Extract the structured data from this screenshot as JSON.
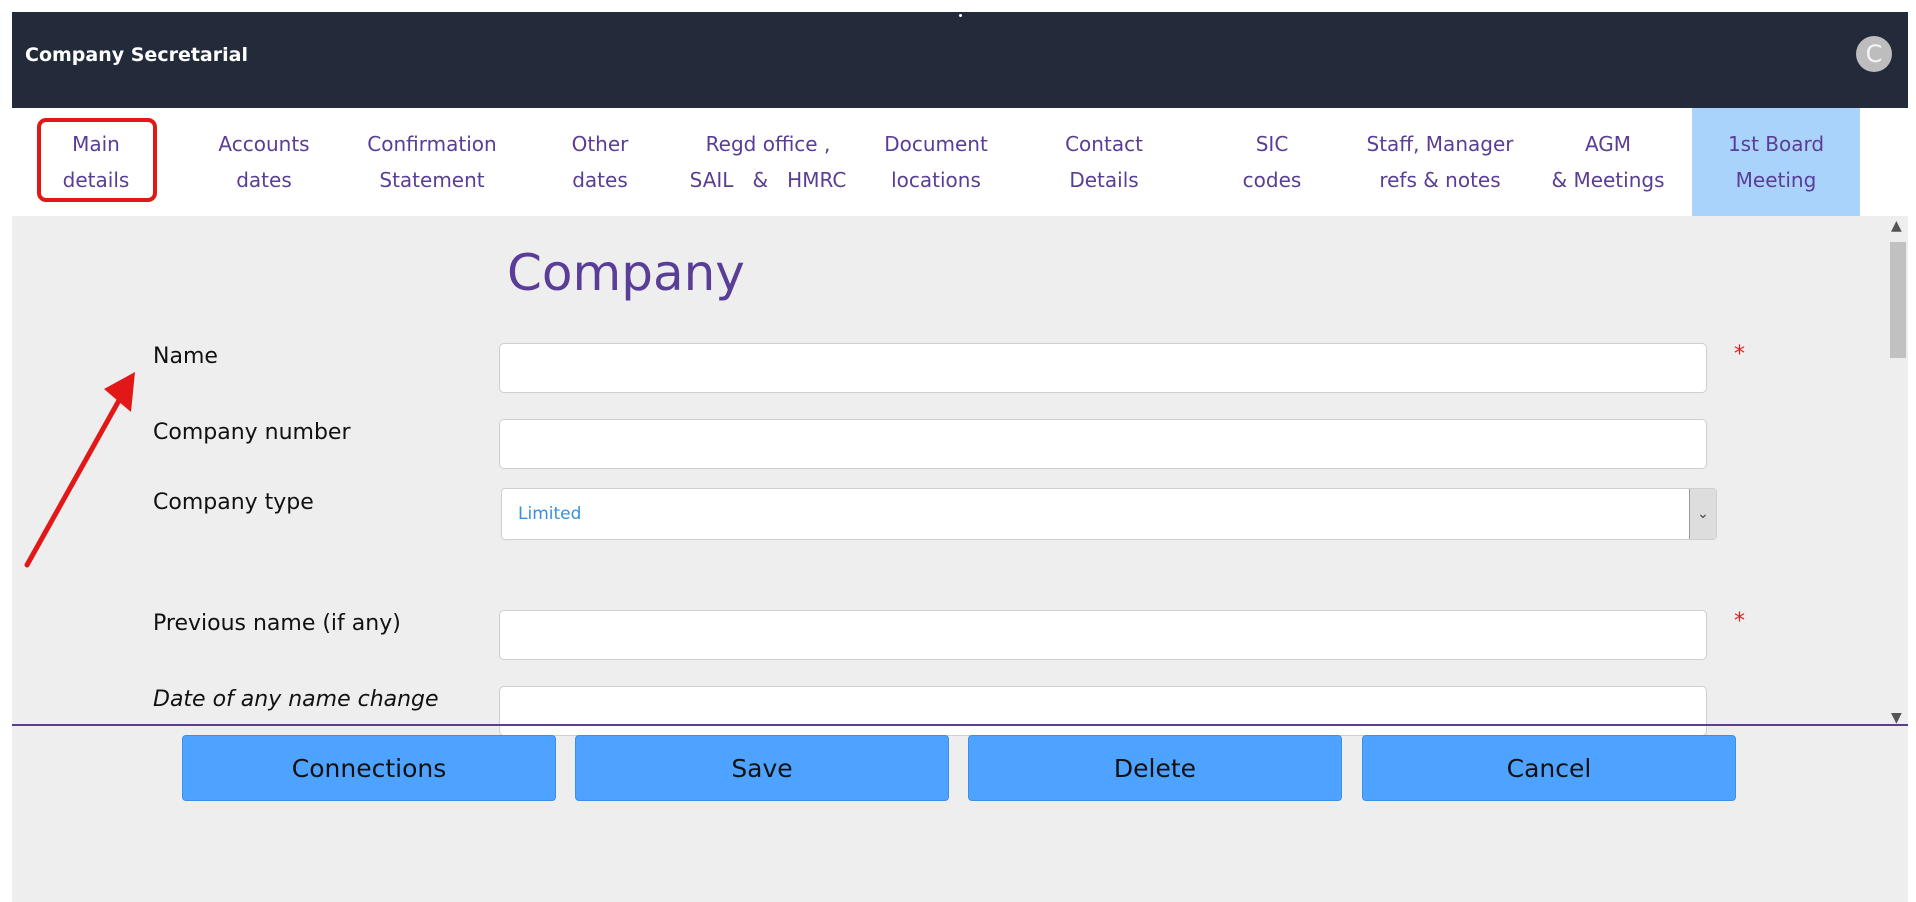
{
  "app": {
    "title": "Company Secretarial",
    "avatar_glyph": "C"
  },
  "tabs": [
    {
      "line1": "Main",
      "line2": "details"
    },
    {
      "line1": "Accounts",
      "line2": "dates"
    },
    {
      "line1": "Confirmation",
      "line2": "Statement"
    },
    {
      "line1": "Other",
      "line2": "dates"
    },
    {
      "line1": "Regd office ,",
      "line2": "SAIL   &   HMRC"
    },
    {
      "line1": "Document",
      "line2": "locations"
    },
    {
      "line1": "Contact",
      "line2": "Details"
    },
    {
      "line1": "SIC",
      "line2": "codes"
    },
    {
      "line1": "Staff, Manager",
      "line2": "refs & notes"
    },
    {
      "line1": "AGM",
      "line2": "& Meetings"
    },
    {
      "line1": "1st Board",
      "line2": "Meeting"
    }
  ],
  "form": {
    "heading": "Company",
    "name_label": "Name",
    "name_value": "",
    "company_number_label": "Company number",
    "company_number_value": "",
    "company_type_label": "Company type",
    "company_type_value": "Limited",
    "previous_name_label": "Previous name (if any)",
    "previous_name_value": "",
    "name_change_date_label": "Date of any name change",
    "name_change_date_value": "",
    "required_marker": "*"
  },
  "buttons": {
    "connections": "Connections",
    "save": "Save",
    "delete": "Delete",
    "cancel": "Cancel"
  },
  "icons": {
    "avatar": "avatar-icon",
    "select_chevron": "chevron-down-icon",
    "scroll_up": "chevron-up-icon",
    "scroll_down": "chevron-down-icon"
  },
  "colors": {
    "topbar": "#232b3a",
    "tab_text": "#5a3d97",
    "active_tab": "#a9d3fb",
    "button": "#4da3ff",
    "required": "#e31d1d",
    "annotation": "#e21818"
  },
  "state": {
    "active_tab": "1st Board Meeting",
    "highlighted_tab": "Main details"
  }
}
